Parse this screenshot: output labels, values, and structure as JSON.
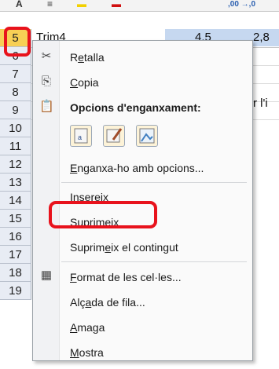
{
  "sheet": {
    "row_labels": [
      "5",
      "6",
      "7",
      "8",
      "9",
      "10",
      "11",
      "12",
      "13",
      "14",
      "15",
      "16",
      "17",
      "18",
      "19"
    ],
    "row5_text": "Trim4",
    "row5_value_a": "4,5",
    "row5_value_b": "2,8",
    "partial_text": "r l'i",
    "selected_row_color": "#f7cf55",
    "highlight_color": "#e8121c"
  },
  "context_menu": {
    "cut": "Retalla",
    "copy": "Copia",
    "paste_options_header": "Opcions d'enganxament:",
    "paste_special": "Enganxa-ho amb opcions...",
    "insert": "Insereix",
    "delete": "Suprimeix",
    "clear_contents": "Suprimeix el contingut",
    "format_cells": "Format de les cel·les...",
    "row_height": "Alçada de fila...",
    "hide": "Amaga",
    "unhide": "Mostra",
    "icons": [
      "scissors-icon",
      "copy-icon",
      "clipboard-icon",
      "paste-values-icon",
      "paste-formatting-icon",
      "paste-picture-icon",
      "format-cells-icon"
    ]
  }
}
